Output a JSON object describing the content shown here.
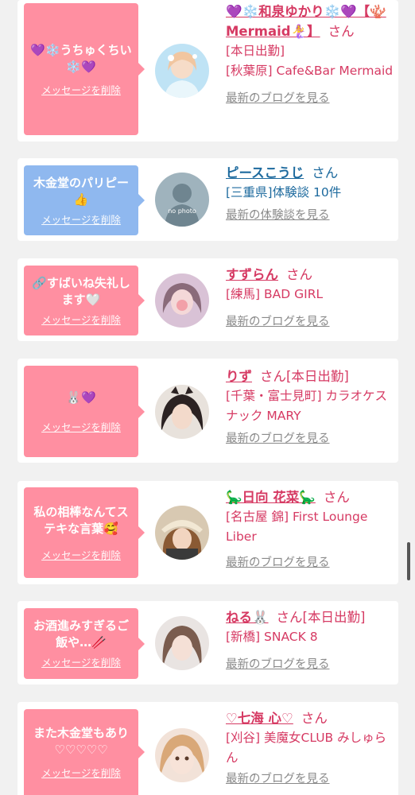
{
  "cards": [
    {
      "message": "💜❄️うちゅくちい❄️💜",
      "delete_label": "メッセージを削除",
      "name": "💜❄️和泉ゆかり❄️💜【🪸Mermaid🧜‍♀️】",
      "san": "さん",
      "details": [
        "[本日出勤]",
        "[秋葉原] Cafe&Bar Mermaid"
      ],
      "more_link": "最新のブログを見る"
    },
    {
      "message": "木金堂のパリピー👍",
      "delete_label": "メッセージを削除",
      "name": "ピースこうじ",
      "san": "さん",
      "details": [
        "[三重県]体験談 10件"
      ],
      "more_link": "最新の体験談を見る",
      "avatar_text": "no photo"
    },
    {
      "message": "🔗すばいね失礼します🤍",
      "delete_label": "メッセージを削除",
      "name": "すずらん",
      "san": "さん",
      "details": [
        "[練馬] BAD GIRL"
      ],
      "more_link": "最新のブログを見る"
    },
    {
      "message": "🐰💜",
      "delete_label": "メッセージを削除",
      "name": "りず",
      "san": "さん[本日出勤]",
      "details": [
        "[千葉・富士見町] カラオケスナック MARY"
      ],
      "more_link": "最新のブログを見る"
    },
    {
      "message": "私の相棒なんてステキな言葉🥰",
      "delete_label": "メッセージを削除",
      "name": "🦕日向 花菜🦕",
      "san": "さん",
      "details": [
        "[名古屋 錦] First Lounge Liber"
      ],
      "more_link": "最新のブログを見る"
    },
    {
      "message": "お酒進みすぎるご飯や…🥢",
      "delete_label": "メッセージを削除",
      "name": "ねる🐰",
      "san": "さん[本日出勤]",
      "details": [
        "[新橋] SNACK 8"
      ],
      "more_link": "最新のブログを見る"
    },
    {
      "message": "また木金堂もあり♡♡♡♡♡",
      "delete_label": "メッセージを削除",
      "name": "♡七海 心♡",
      "san": "さん",
      "details": [
        "[刈谷] 美魔女CLUB みしゅらん"
      ],
      "more_link": "最新のブログを見る"
    }
  ]
}
